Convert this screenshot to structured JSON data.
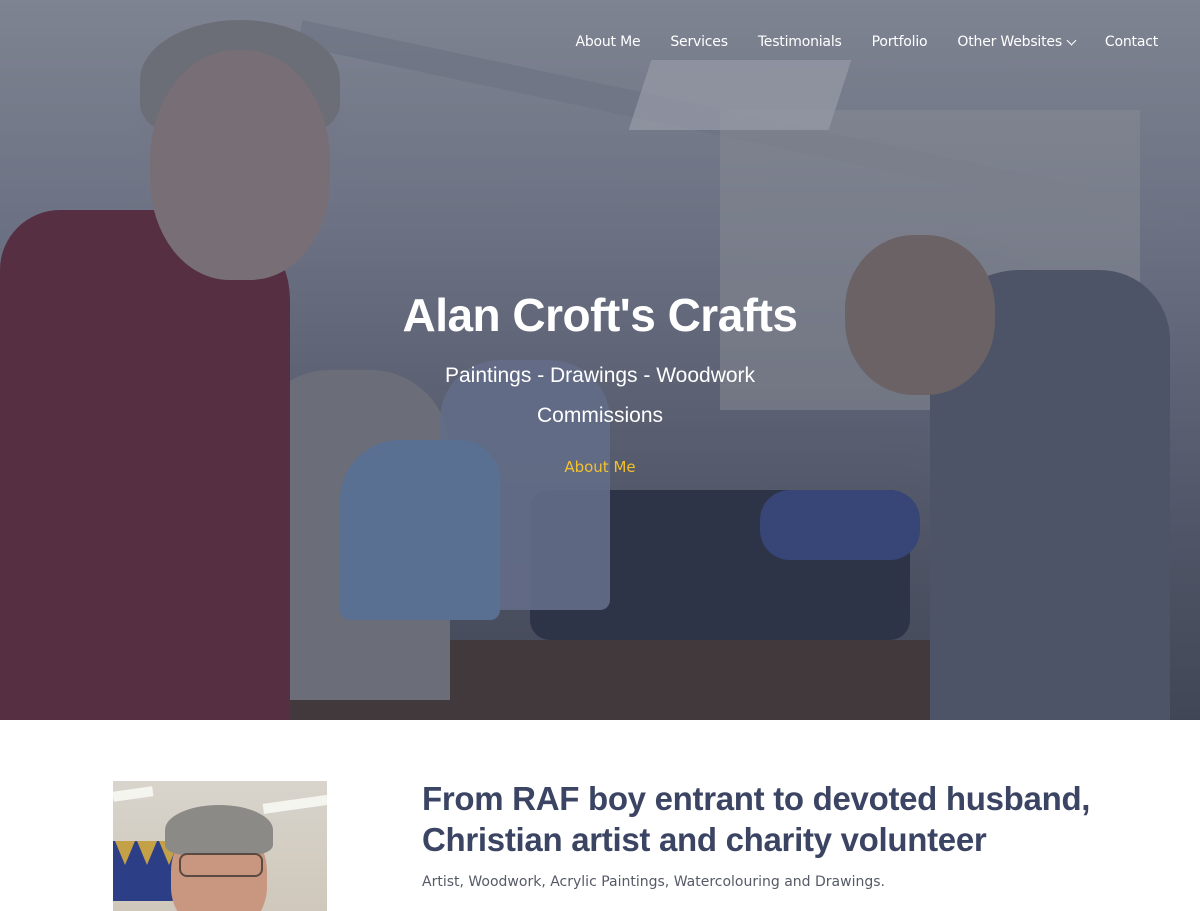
{
  "nav": {
    "items": [
      {
        "label": "About Me"
      },
      {
        "label": "Services"
      },
      {
        "label": "Testimonials"
      },
      {
        "label": "Portfolio"
      },
      {
        "label": "Other Websites",
        "dropdown": true
      },
      {
        "label": "Contact"
      }
    ]
  },
  "hero": {
    "title": "Alan Croft's Crafts",
    "subtitle": "Paintings - Drawings - Woodwork",
    "subtitle2": "Commissions",
    "cta_label": "About Me"
  },
  "article": {
    "heading": "From RAF boy entrant to devoted husband, Christian artist and charity volunteer",
    "subheading": "Artist, Woodwork, Acrylic Paintings, Watercolouring and Drawings."
  },
  "colors": {
    "accent": "#f2c12e",
    "heading": "#3b4563"
  }
}
